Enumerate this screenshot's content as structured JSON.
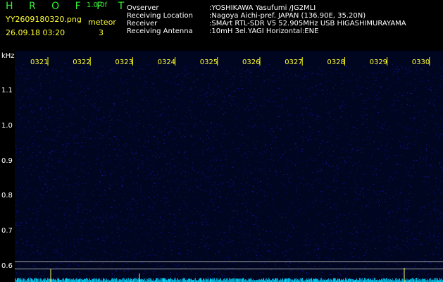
{
  "header": {
    "title": "H R O F F T",
    "version": "1.0.0f",
    "filename": "YY2609180320.png",
    "mode": "meteor",
    "datetime": "26.09.18 03:20",
    "count": "3"
  },
  "meta": [
    {
      "key": "Ovserver",
      "value": ":YOSHIKAWA Yasufumi /JG2MLI"
    },
    {
      "key": "Receiving Location",
      "value": ":Nagoya Aichi-pref. JAPAN (136.90E, 35.20N)"
    },
    {
      "key": "Receiver",
      "value": ":SMArt RTL-SDR V5 52.905MHz USB HIGASHIMURAYAMA"
    },
    {
      "key": "Receiving Antenna",
      "value": ":10mH 3el.YAGI Horizontal:ENE"
    }
  ],
  "spectrogram": {
    "unit": "kHz",
    "time_labels": [
      "0321",
      "0322",
      "0323",
      "0324",
      "0325",
      "0326",
      "0327",
      "0328",
      "0329",
      "0330"
    ],
    "freq_labels": [
      "1.1",
      "1.0",
      "0.9",
      "0.8",
      "0.7",
      "0.6"
    ],
    "freq_values": [
      1.1,
      1.0,
      0.9,
      0.8,
      0.7,
      0.6
    ],
    "ref_lines_khz": [
      0.62,
      0.605
    ],
    "colors": {
      "background": "#000520",
      "noise": "#1a1aa8",
      "baseline": "#00d8ff",
      "tick": "#ffff00",
      "label": "#ffff33",
      "ref_line": "#aaaaaa"
    }
  }
}
